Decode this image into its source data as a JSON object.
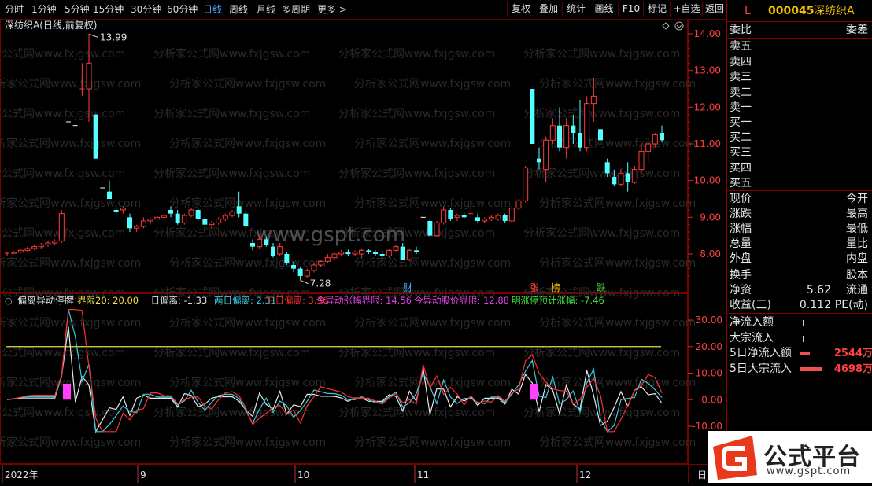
{
  "toolbar": {
    "periods": [
      "分时",
      "1分钟",
      "5分钟",
      "15分钟",
      "30分钟",
      "60分钟",
      "日线",
      "周线",
      "月线",
      "多周期",
      "更多 >"
    ],
    "active_period": "日线",
    "buttons": [
      "复权",
      "叠加",
      "统计",
      "画线",
      "F10",
      "标记",
      "+自选",
      "返回"
    ]
  },
  "main_chart": {
    "title": "深纺织A(日线,前复权)",
    "price_ticks": [
      "14.00",
      "13.00",
      "12.00",
      "11.00",
      "10.00",
      "9.00",
      "8.00"
    ],
    "high_label": "13.99",
    "low_label": "7.28",
    "markers": [
      {
        "text": "财",
        "color": "#3fa9ff"
      },
      {
        "text": "涨",
        "color": "#ff4040"
      },
      {
        "text": "榜",
        "color": "#f0c000"
      },
      {
        "text": "跌",
        "color": "#40c040"
      }
    ],
    "watermark": "www.gspt.com",
    "bg_watermark": "分析家公式网www.fxjgsw.com"
  },
  "indicator": {
    "name": "偏离异动停牌",
    "items": [
      {
        "label": "界限20: 20.00",
        "color": "#f0e040"
      },
      {
        "label": "一日偏离: -1.33",
        "color": "#e0e0e0"
      },
      {
        "label": "两日偏离: 2.31",
        "color": "#40c8e0"
      },
      {
        "label": "三日偏离: 3.36",
        "color": "#ff3030"
      },
      {
        "label": "今异动涨幅界限: 14.56",
        "color": "#e040e0"
      },
      {
        "label": "今异动股价界限: 12.88",
        "color": "#e040e0"
      },
      {
        "label": "明涨停预计涨幅: -7.46",
        "color": "#40e040"
      }
    ],
    "ticks": [
      "30.00",
      "20.00",
      "10.00",
      "0.00",
      "-10.00"
    ]
  },
  "xaxis": {
    "labels": [
      "2022年",
      "9",
      "10",
      "11",
      "12"
    ],
    "right_label": "日"
  },
  "quote": {
    "code": "000045",
    "name": "深纺织A",
    "badge": "L",
    "order_rows": [
      [
        "委比",
        "委差"
      ]
    ],
    "sells": [
      "卖五",
      "卖四",
      "卖三",
      "卖二",
      "卖一"
    ],
    "buys": [
      "买一",
      "买二",
      "买三",
      "买四",
      "买五"
    ],
    "stats": [
      [
        "现价",
        "今开"
      ],
      [
        "涨跌",
        "最高"
      ],
      [
        "涨幅",
        "最低"
      ],
      [
        "总量",
        "量比"
      ],
      [
        "外盘",
        "内盘"
      ]
    ],
    "extra": [
      {
        "l": "换手",
        "m": "",
        "r": "股本"
      },
      {
        "l": "净资",
        "m": "5.62",
        "r": "流通"
      },
      {
        "l": "收益(三)",
        "m": "0.112",
        "r": "PE(动)"
      }
    ],
    "flows": [
      {
        "label": "净流入额",
        "value": ""
      },
      {
        "label": "大宗流入",
        "value": ""
      },
      {
        "label": "5日净流入额",
        "value": "2544万"
      },
      {
        "label": "5日大宗流入",
        "value": "4698万"
      }
    ]
  },
  "logo": {
    "text": "公式平台",
    "url": "www.gspt.com"
  },
  "colors": {
    "up": "#ff3b3b",
    "down": "#54ffff",
    "frame": "#7a0000"
  },
  "candles": [
    [
      8.0,
      8.05,
      7.95,
      8.02
    ],
    [
      8.02,
      8.08,
      8.0,
      8.05
    ],
    [
      8.05,
      8.12,
      8.03,
      8.1
    ],
    [
      8.1,
      8.2,
      8.05,
      8.15
    ],
    [
      8.15,
      8.25,
      8.1,
      8.2
    ],
    [
      8.2,
      8.3,
      8.15,
      8.25
    ],
    [
      8.25,
      8.35,
      8.2,
      8.3
    ],
    [
      8.3,
      8.4,
      8.25,
      8.35
    ],
    [
      8.35,
      9.2,
      8.3,
      9.1
    ],
    [
      11.6,
      11.6,
      11.6,
      11.6
    ],
    [
      11.5,
      11.5,
      11.5,
      11.5
    ],
    [
      12.5,
      13.2,
      12.3,
      12.5
    ],
    [
      12.5,
      13.99,
      11.6,
      13.2
    ],
    [
      11.8,
      11.8,
      10.6,
      10.6
    ],
    [
      9.8,
      9.8,
      9.8,
      9.8
    ],
    [
      9.7,
      10.0,
      9.5,
      9.5
    ],
    [
      9.2,
      9.3,
      9.1,
      9.15
    ],
    [
      9.2,
      9.3,
      9.1,
      9.25
    ],
    [
      9.0,
      9.1,
      8.6,
      8.7
    ],
    [
      8.7,
      8.8,
      8.6,
      8.75
    ],
    [
      8.75,
      9.0,
      8.7,
      8.9
    ],
    [
      8.9,
      9.0,
      8.8,
      8.95
    ],
    [
      8.95,
      9.05,
      8.9,
      9.0
    ],
    [
      9.0,
      9.1,
      8.9,
      9.05
    ],
    [
      9.2,
      9.3,
      9.0,
      9.1
    ],
    [
      9.1,
      9.2,
      8.8,
      8.85
    ],
    [
      8.85,
      9.1,
      8.8,
      9.05
    ],
    [
      9.05,
      9.25,
      9.0,
      9.2
    ],
    [
      9.2,
      9.25,
      8.9,
      8.95
    ],
    [
      8.95,
      9.0,
      8.75,
      8.8
    ],
    [
      8.8,
      8.9,
      8.7,
      8.85
    ],
    [
      8.85,
      9.0,
      8.8,
      8.95
    ],
    [
      8.95,
      9.1,
      8.9,
      9.05
    ],
    [
      9.05,
      9.2,
      9.0,
      9.15
    ],
    [
      9.3,
      9.7,
      9.0,
      9.1
    ],
    [
      9.1,
      9.2,
      8.7,
      8.75
    ],
    [
      8.3,
      8.4,
      8.1,
      8.2
    ],
    [
      8.2,
      8.5,
      8.15,
      8.4
    ],
    [
      8.4,
      8.45,
      8.2,
      8.25
    ],
    [
      8.2,
      8.3,
      7.9,
      7.95
    ],
    [
      8.0,
      8.3,
      7.95,
      8.2
    ],
    [
      8.0,
      8.05,
      7.7,
      7.75
    ],
    [
      7.7,
      7.8,
      7.5,
      7.6
    ],
    [
      7.6,
      7.65,
      7.28,
      7.4
    ],
    [
      7.4,
      7.6,
      7.35,
      7.55
    ],
    [
      7.55,
      7.75,
      7.5,
      7.7
    ],
    [
      7.7,
      7.85,
      7.65,
      7.8
    ],
    [
      7.8,
      8.0,
      7.75,
      7.9
    ],
    [
      7.9,
      8.05,
      7.85,
      8.0
    ],
    [
      8.0,
      8.1,
      7.95,
      8.05
    ],
    [
      8.05,
      8.12,
      7.95,
      8.0
    ],
    [
      8.0,
      8.1,
      7.95,
      8.05
    ],
    [
      8.0,
      8.15,
      7.9,
      8.1
    ],
    [
      8.1,
      8.15,
      8.0,
      8.05
    ],
    [
      8.05,
      8.1,
      7.95,
      8.0
    ],
    [
      8.0,
      8.1,
      7.85,
      7.95
    ],
    [
      7.95,
      8.15,
      7.9,
      8.1
    ],
    [
      8.1,
      8.25,
      8.05,
      8.2
    ],
    [
      8.2,
      8.3,
      7.85,
      7.85
    ],
    [
      7.85,
      8.15,
      7.8,
      8.1
    ],
    [
      8.1,
      8.2,
      8.0,
      8.05
    ],
    [
      9.0,
      9.0,
      9.0,
      9.0
    ],
    [
      8.9,
      8.95,
      8.45,
      8.5
    ],
    [
      8.5,
      8.9,
      8.45,
      8.85
    ],
    [
      8.85,
      9.3,
      8.8,
      9.2
    ],
    [
      9.2,
      9.25,
      8.9,
      8.95
    ],
    [
      9.0,
      9.1,
      8.9,
      9.05
    ],
    [
      9.05,
      9.15,
      8.95,
      9.0
    ],
    [
      9.1,
      9.5,
      9.0,
      9.1
    ],
    [
      9.0,
      9.1,
      8.85,
      8.9
    ],
    [
      8.9,
      9.0,
      8.85,
      8.95
    ],
    [
      8.95,
      9.05,
      8.9,
      9.0
    ],
    [
      8.95,
      9.1,
      8.9,
      9.05
    ],
    [
      9.05,
      9.1,
      8.85,
      8.9
    ],
    [
      8.9,
      9.3,
      8.85,
      9.25
    ],
    [
      9.25,
      9.5,
      9.2,
      9.45
    ],
    [
      9.45,
      10.4,
      9.4,
      10.35
    ],
    [
      12.5,
      12.5,
      11.0,
      11.0
    ],
    [
      10.6,
      10.9,
      10.3,
      10.5
    ],
    [
      10.3,
      11.2,
      9.95,
      11.1
    ],
    [
      11.1,
      11.7,
      11.0,
      11.5
    ],
    [
      11.5,
      12.0,
      10.8,
      10.9
    ],
    [
      10.9,
      11.7,
      10.6,
      11.5
    ],
    [
      11.5,
      11.8,
      11.0,
      11.3
    ],
    [
      11.3,
      12.2,
      10.8,
      10.9
    ],
    [
      10.9,
      12.3,
      10.8,
      12.1
    ],
    [
      12.1,
      12.8,
      11.6,
      12.3
    ],
    [
      11.4,
      11.4,
      11.1,
      11.1
    ],
    [
      10.5,
      10.6,
      10.1,
      10.2
    ],
    [
      10.1,
      10.3,
      9.85,
      9.9
    ],
    [
      9.9,
      10.3,
      9.85,
      10.2
    ],
    [
      10.2,
      10.5,
      9.7,
      9.95
    ],
    [
      9.95,
      10.4,
      9.9,
      10.3
    ],
    [
      10.3,
      11.0,
      10.2,
      10.8
    ],
    [
      10.8,
      11.2,
      10.5,
      11.0
    ],
    [
      11.0,
      11.3,
      10.9,
      11.25
    ],
    [
      11.3,
      11.5,
      11.05,
      11.1
    ]
  ]
}
